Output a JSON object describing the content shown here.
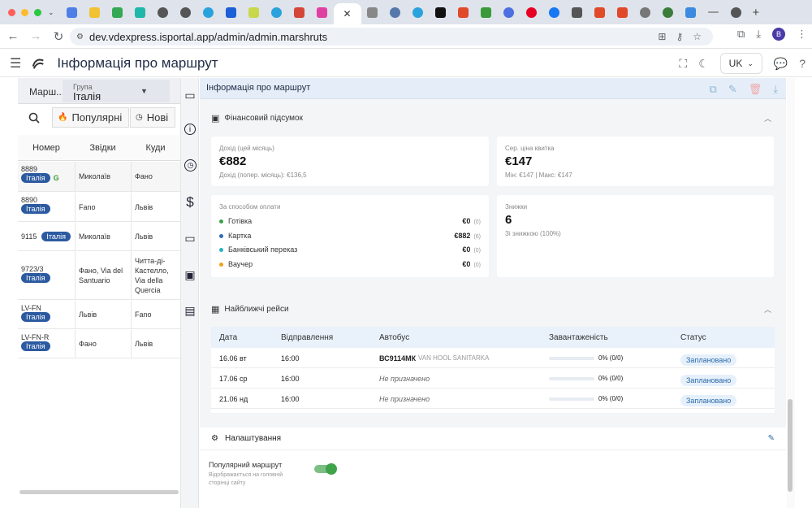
{
  "browser": {
    "url": "dev.vdexpress.isportal.app/admin/admin.marshruts",
    "profile_initial": "B"
  },
  "app": {
    "title": "Інформація про маршрут",
    "lang": "UK"
  },
  "left": {
    "route_trunc": "Марш...",
    "group_label": "Група",
    "group_value": "Італія",
    "btn_popular": "Популярні",
    "btn_new": "Нові",
    "columns": [
      "Номер",
      "Звідки",
      "Куди"
    ],
    "rows": [
      {
        "num": "8889",
        "badge": "Італія",
        "from": "Миколаїв",
        "to": "Фано"
      },
      {
        "num": "8890",
        "badge": "Італія",
        "from": "Fano",
        "to": "Львів"
      },
      {
        "num": "9115",
        "badge": "Італія",
        "from": "Миколаїв",
        "to": "Львів"
      },
      {
        "num": "9723/3",
        "badge": "Італія",
        "from": "Фано, Via del Santuario",
        "to": "Читта-ді-Кастелло, Via della Quercia"
      },
      {
        "num": "LV-FN",
        "badge": "Італія",
        "from": "Львів",
        "to": "Fano"
      },
      {
        "num": "LV-FN-R",
        "badge": "Італія",
        "from": "Фано",
        "to": "Львів"
      }
    ]
  },
  "main": {
    "header": "Інформація про маршрут",
    "fin_title": "Фінансовий підсумок",
    "income_label": "Дохід (цей місяць)",
    "income_value": "€882",
    "income_prev": "Дохід (попер. місяць): €136,5",
    "avg_label": "Сер. ціна квитка",
    "avg_value": "€147",
    "avg_minmax": "Мін: €147 | Макс: €147",
    "pay_label": "За способом оплати",
    "payments": [
      {
        "name": "Готівка",
        "amount": "€0",
        "count": "(0)",
        "color": "#3aa34a"
      },
      {
        "name": "Картка",
        "amount": "€882",
        "count": "(6)",
        "color": "#2d6bb3"
      },
      {
        "name": "Банківський переказ",
        "amount": "€0",
        "count": "(0)",
        "color": "#2bb0c4"
      },
      {
        "name": "Ваучер",
        "amount": "€0",
        "count": "(0)",
        "color": "#f0a020"
      }
    ],
    "disc_label": "Знижки",
    "disc_value": "6",
    "disc_note": "Зі знижкою (100%)",
    "trips_title": "Найближчі рейси",
    "trip_cols": [
      "Дата",
      "Відправлення",
      "Автобус",
      "Завантаженість",
      "Статус"
    ],
    "trips": [
      {
        "date": "16.06 вт",
        "time": "16:00",
        "bus": "ВС9114МК",
        "bus_model": "VAN HOOL SANITARKA",
        "load_text": "0% (0/0)",
        "load": 0,
        "status": "Заплановано"
      },
      {
        "date": "17.06 ср",
        "time": "16:00",
        "bus": "Не призначено",
        "bus_model": "",
        "load_text": "0% (0/0)",
        "load": 0,
        "status": "Заплановано"
      },
      {
        "date": "21.06 нд",
        "time": "16:00",
        "bus": "Не призначено",
        "bus_model": "",
        "load_text": "0% (0/0)",
        "load": 0,
        "status": "Заплановано"
      }
    ],
    "settings_title": "Налаштування",
    "popular_title": "Популярний маршрут",
    "popular_note": "Відображається на головній сторінці сайту",
    "popular_on": true
  }
}
